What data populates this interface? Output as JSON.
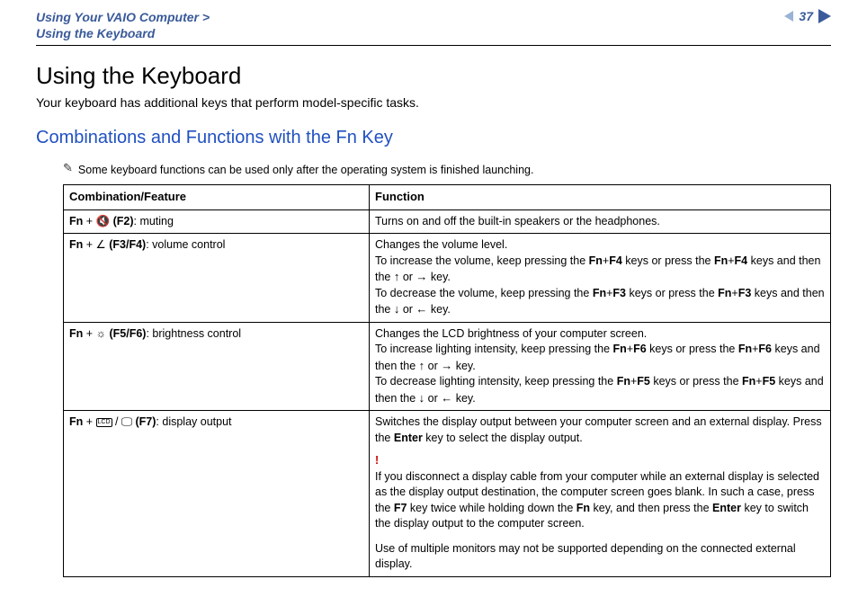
{
  "header": {
    "breadcrumb_line1": "Using Your VAIO Computer >",
    "breadcrumb_line2": "Using the Keyboard",
    "page_number": "37"
  },
  "main": {
    "title": "Using the Keyboard",
    "intro": "Your keyboard has additional keys that perform model-specific tasks.",
    "subtitle": "Combinations and Functions with the Fn Key",
    "note": "Some keyboard functions can be used only after the operating system is finished launching."
  },
  "table": {
    "headers": {
      "col1": "Combination/Feature",
      "col2": "Function"
    },
    "row1": {
      "fn": "Fn",
      "key": " (F2)",
      "desc": ": muting",
      "func": "Turns on and off the built-in speakers or the headphones."
    },
    "row2": {
      "fn": "Fn",
      "key": " (F3/F4)",
      "desc": ": volume control",
      "f_line1": "Changes the volume level.",
      "f_inc_a": "To increase the volume, keep pressing the ",
      "f_inc_k1": "Fn",
      "f_inc_plus1": "+",
      "f_inc_k2": "F4",
      "f_inc_b": " keys or press the ",
      "f_inc_k3": "Fn",
      "f_inc_plus2": "+",
      "f_inc_k4": "F4",
      "f_inc_c": " keys and then the ",
      "f_inc_or": " or ",
      "f_inc_end": " key.",
      "f_dec_a": "To decrease the volume, keep pressing the ",
      "f_dec_k1": "Fn",
      "f_dec_plus1": "+",
      "f_dec_k2": "F3",
      "f_dec_b": " keys or press the ",
      "f_dec_k3": "Fn",
      "f_dec_plus2": "+",
      "f_dec_k4": "F3",
      "f_dec_c": " keys and then the ",
      "f_dec_or": " or ",
      "f_dec_end": " key."
    },
    "row3": {
      "fn": "Fn",
      "key": " (F5/F6)",
      "desc": ": brightness control",
      "f_line1": "Changes the LCD brightness of your computer screen.",
      "f_inc_a": "To increase lighting intensity, keep pressing the ",
      "f_inc_k1": "Fn",
      "f_inc_plus1": "+",
      "f_inc_k2": "F6",
      "f_inc_b": " keys or press the ",
      "f_inc_k3": "Fn",
      "f_inc_plus2": "+",
      "f_inc_k4": "F6",
      "f_inc_c": " keys and then the ",
      "f_inc_or": " or ",
      "f_inc_end": " key.",
      "f_dec_a": "To decrease lighting intensity, keep pressing the ",
      "f_dec_k1": "Fn",
      "f_dec_plus1": "+",
      "f_dec_k2": "F5",
      "f_dec_b": " keys or press the ",
      "f_dec_k3": "Fn",
      "f_dec_plus2": "+",
      "f_dec_k4": "F5",
      "f_dec_c": " keys and then the ",
      "f_dec_or": " or ",
      "f_dec_end": " key."
    },
    "row4": {
      "fn": "Fn",
      "key": " (F7)",
      "desc": ": display output",
      "f_a": "Switches the display output between your computer screen and an external display. Press the ",
      "f_enter1": "Enter",
      "f_b": " key to select the display output.",
      "warn_mark": "!",
      "f_c": "If you disconnect a display cable from your computer while an external display is selected as the display output destination, the computer screen goes blank. In such a case, press the ",
      "f_f7": "F7",
      "f_d": " key twice while holding down the ",
      "f_fn": "Fn",
      "f_e": " key, and then press the ",
      "f_enter2": "Enter",
      "f_f": " key to switch the display output to the computer screen.",
      "f_g": "Use of multiple monitors may not be supported depending on the connected external display."
    }
  }
}
